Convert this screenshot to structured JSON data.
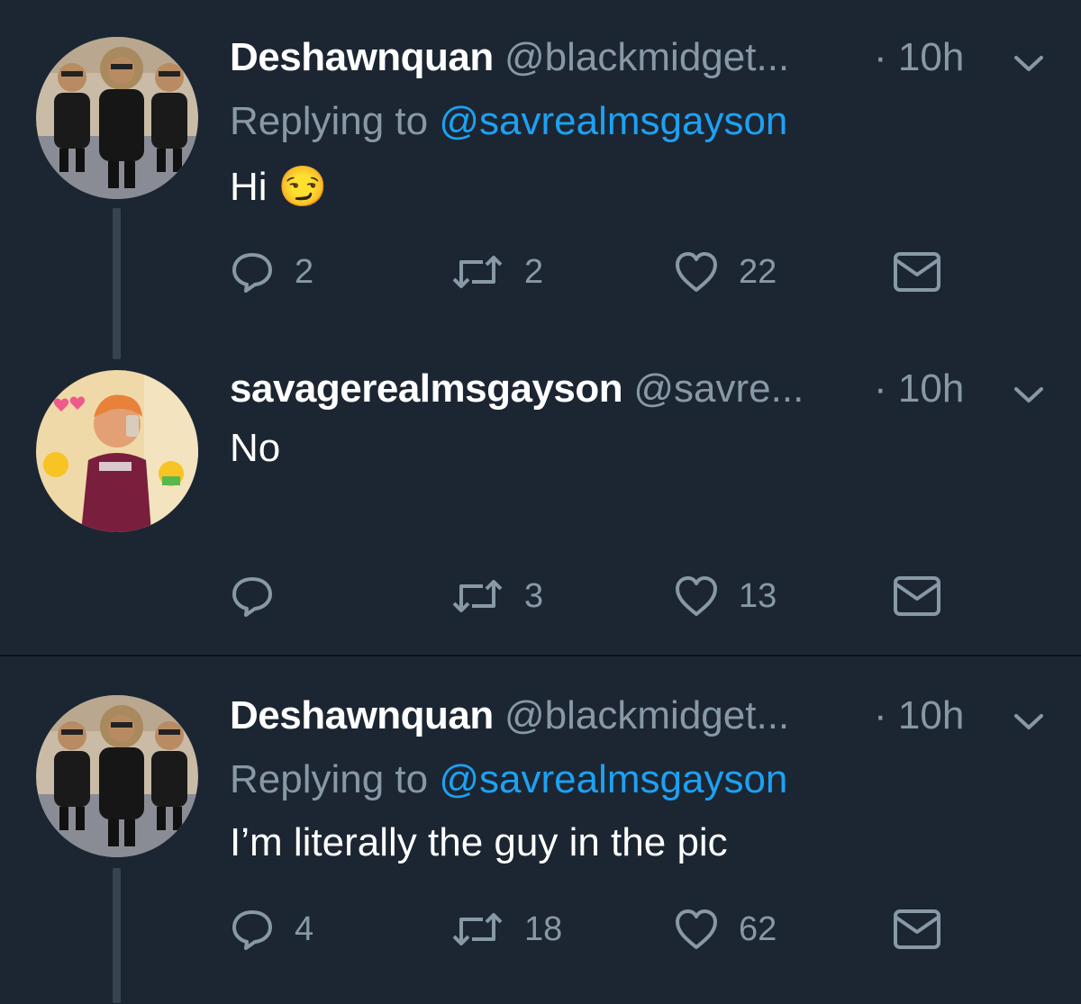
{
  "colors": {
    "background": "#1c2632",
    "text_primary": "#ffffff",
    "text_secondary": "#8899a6",
    "mention": "#1da1f2",
    "thread_line": "#38444d"
  },
  "tweets": [
    {
      "display_name": "Deshawnquan",
      "handle": "@blackmidget...",
      "time": "· 10h",
      "replying_prefix": "Replying to ",
      "replying_to": "@savrealmsgayson",
      "text": "Hi 😏",
      "reply_count": "2",
      "retweet_count": "2",
      "like_count": "22",
      "icons": [
        "reply-icon",
        "retweet-icon",
        "heart-icon",
        "dm-icon",
        "chevron-down-icon"
      ]
    },
    {
      "display_name": "savagerealmsgayson",
      "handle": "@savre...",
      "time": "· 10h",
      "text": "No",
      "reply_count": "",
      "retweet_count": "3",
      "like_count": "13",
      "icons": [
        "reply-icon",
        "retweet-icon",
        "heart-icon",
        "dm-icon",
        "chevron-down-icon"
      ]
    },
    {
      "display_name": "Deshawnquan",
      "handle": "@blackmidget...",
      "time": "· 10h",
      "replying_prefix": "Replying to ",
      "replying_to": "@savrealmsgayson",
      "text": "I’m literally the guy in the pic",
      "reply_count": "4",
      "retweet_count": "18",
      "like_count": "62",
      "icons": [
        "reply-icon",
        "retweet-icon",
        "heart-icon",
        "dm-icon",
        "chevron-down-icon"
      ]
    }
  ]
}
